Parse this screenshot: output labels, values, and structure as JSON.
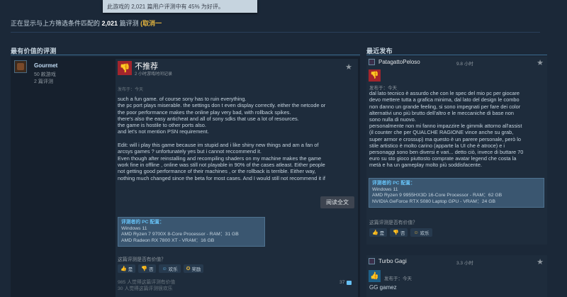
{
  "tooltip": "此游戏的 2,021 篇用户评测中有 45% 为好评。",
  "filter": {
    "prefix": "正在显示与上方筛选条件匹配的",
    "count": "2,021",
    "suffix": "篇评测",
    "clear": "(取消一"
  },
  "sections": {
    "helpful": "最有价值的评测",
    "recent": "最近发布"
  },
  "left_review": {
    "author": "Gourmet",
    "products": "50 款游戏",
    "reviews": "2 篇评测",
    "verdict": "不推荐",
    "hours": "2 小时游戏时间记录",
    "posted": "发布于：今天",
    "body": [
      "such a fun game. of course sony has to ruin everything.",
      "the pc port plays miserable. the settings don t even display correctly. either the netcode or",
      "the poor performance makes the online play very bad, with rollback spikes.",
      "there's also the easy anticheat and all of sony sdks that use a lot of resources.",
      "the game is hostile to other ports also.",
      "and let's not mention PSN requirement.",
      "",
      "Edit: will i play this game because im stupid and i like shiny new things and am a fan of",
      "arcsys games ? unfortunately yes but i cannot reccommend it.",
      "Even though after reinstalling and recompiling shaders on my machine makes the game",
      "work fine in offline , online was still not playable in 90% of the cases atleast. Either people",
      "not getting good performance of their machines , or the rollback is terrible. Either way,",
      "nothing much changed since the beta for most cases. And I would still not recommend it if"
    ],
    "read_more": "阅读全文",
    "pc_title": "评测者的 PC 配置：",
    "pc_specs": [
      "Windows 11",
      "AMD Ryzen 7 9700X 8-Core Processor - RAM：31 GB",
      "AMD Radeon RX 7800 XT - VRAM：16 GB"
    ],
    "helpful_question": "这篇评测是否有价值？",
    "buttons": {
      "yes": "是",
      "no": "否",
      "funny": "欢乐",
      "award": "奖励"
    },
    "helpful_lines": [
      "985 人觉得这篇评测有价值",
      "30 人觉得这篇评测很欢乐"
    ],
    "comments": "37"
  },
  "right_reviews": [
    {
      "author": "PatagattoPeloso",
      "hours": "9.8 小时",
      "posted": "发布于：今天",
      "body": [
        "dal lato tecnico è assurdo che con le spec del mio pc per giocare",
        "devo mettere tutta a grafica minima, dal lato del design le combo",
        "non danno un grande feeling, si sono impegnati per fare dei color",
        "alternativi uno più brutto dell'altro e le meccaniche di base non",
        "sono nulla di nuovo.",
        "personalmente non mi fanno impazzire le gimmik attorno all'assist",
        "(il counter che per QUALCHE RAGIONE vince anche su grab,",
        "super armor e crossup) ma questo è un parere personale, però lo",
        "stile artistico è molto carino (apparte la UI che è atroce) e i",
        "personaggi sono ben diversi e vari... detto ciò, invece di buttare 70",
        "euro su sto gioco piuttosto comprate avatar legend che costa la",
        "metà e ha un gameplay molto più soddisfacente."
      ],
      "pc_title": "评测者的 PC 配置：",
      "pc_specs": [
        "Windows 11",
        "AMD Ryzen 9 9955HX3D 16-Core Processor - RAM：62 GB",
        "NVIDIA GeForce RTX 5080 Laptop GPU - VRAM：24 GB"
      ],
      "helpful_question": "这篇评测是否有价值？",
      "buttons": {
        "yes": "是",
        "no": "否",
        "funny": "欢乐"
      }
    },
    {
      "author": "Turbo Gagi",
      "hours": "3.3 小时",
      "posted": "发布于：今天",
      "body": [
        "GG gamez"
      ]
    }
  ]
}
